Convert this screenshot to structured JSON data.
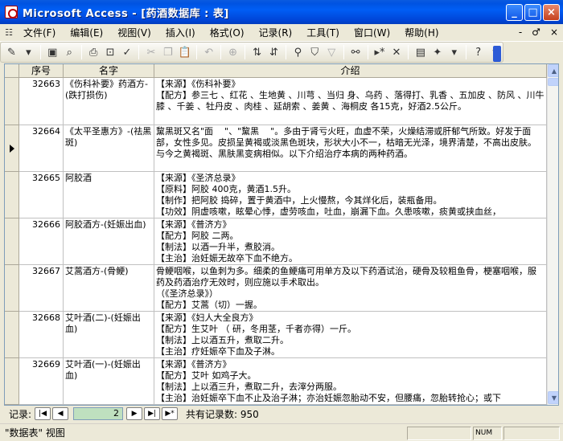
{
  "window": {
    "title": "Microsoft Access - [药酒数据库 : 表]",
    "minimize": "_",
    "maximize": "□",
    "close": "×"
  },
  "menu": {
    "items": [
      "文件(F)",
      "编辑(E)",
      "视图(V)",
      "插入(I)",
      "格式(O)",
      "记录(R)",
      "工具(T)",
      "窗口(W)",
      "帮助(H)"
    ],
    "win_controls": [
      "-",
      "♂",
      "×"
    ]
  },
  "grid": {
    "columns": [
      "序号",
      "名字",
      "介绍"
    ],
    "current_row_index": 1,
    "rows": [
      {
        "id": "32663",
        "name": "《伤科补要》药酒方-(跌打损伤)",
        "intro": "【来源】《伤科补要》\n【配方】参三七 、红花 、生地黄 、川芎 、当归 身、乌药 、落得打、乳香 、五加皮 、防风 、川牛膝 、千姜 、牡丹皮 、肉桂 、延胡索 、姜黄 、海桐皮 各15克，好酒2.5公斤。"
      },
      {
        "id": "32664",
        "name": "《太平圣惠方》-(祛黑斑)",
        "intro": "黧黑斑又名\"面    \"、\"黧黑    \"。多由于肾亏火旺，血虚不荣，火燥结滞或肝郁气所致。好发于面部，女性多见。皮损呈黄褐或淡黑色斑块，形状大小不一，枯暗无光泽，境界清楚，不高出皮肤。与今之黄褐斑、黑肤黑变病相似。以下介绍治疗本病的两种药酒。"
      },
      {
        "id": "32665",
        "name": "阿胶酒",
        "intro": "【来源】《圣济总录》\n【原料】阿胶 400克，黄酒1.5升。\n【制作】把阿胶 捣碎，置于黄酒中，上火慢熬，今其烊化后，装瓶备用。\n【功效】阴虚咳嗽，眩晕心悸，虚劳咳血，吐血，崩漏下血。久患咳嗽，痰黄或挟血丝，"
      },
      {
        "id": "32666",
        "name": "阿胶酒方-(妊娠出血)",
        "intro": "【来源】《普济方》\n【配方】阿胶 二两。\n【制法】以酒一升半，煮胶消。\n【主治】治妊娠无故卒下血不绝方。"
      },
      {
        "id": "32667",
        "name": "艾蒿酒方-(骨鲠)",
        "intro": "骨鲠咽喉，以鱼刺为多。细柔的鱼鲠痛可用单方及以下药酒试治，硬骨及较粗鱼骨，梗塞咽喉，服药及药酒治疗无效时，则应施以手术取出。\n（《圣济总录》）\n【配方】艾蒿（切）一握。"
      },
      {
        "id": "32668",
        "name": "艾叶酒(二)-(妊娠出血)",
        "intro": "【来源】《妇人大全良方》\n【配方】生艾叶 （ 研，冬用茎，千者亦得）一斤。\n【制法】上以酒五升，煮取二升。\n【主治】疗妊娠卒下血及子淋。"
      },
      {
        "id": "32669",
        "name": "艾叶酒(一)-(妊娠出血)",
        "intro": "【来源】《普济方》\n【配方】艾叶 如鸡子大。\n【制法】上以酒三升，煮取二升，去滓分两服。\n【主治】治妊娠卒下血不止及治子淋；亦治妊娠忽胎动不安，但腰痛，忽胎转抢心；或下"
      }
    ]
  },
  "navigator": {
    "label": "记录:",
    "current": "2",
    "total_text": "共有记录数: 950",
    "first_icon": "first-record-icon",
    "prev_icon": "prev-record-icon",
    "next_icon": "next-record-icon",
    "last_icon": "last-record-icon",
    "new_icon": "new-record-icon"
  },
  "status": {
    "view": "\"数据表\" 视图",
    "num": "NUM"
  }
}
